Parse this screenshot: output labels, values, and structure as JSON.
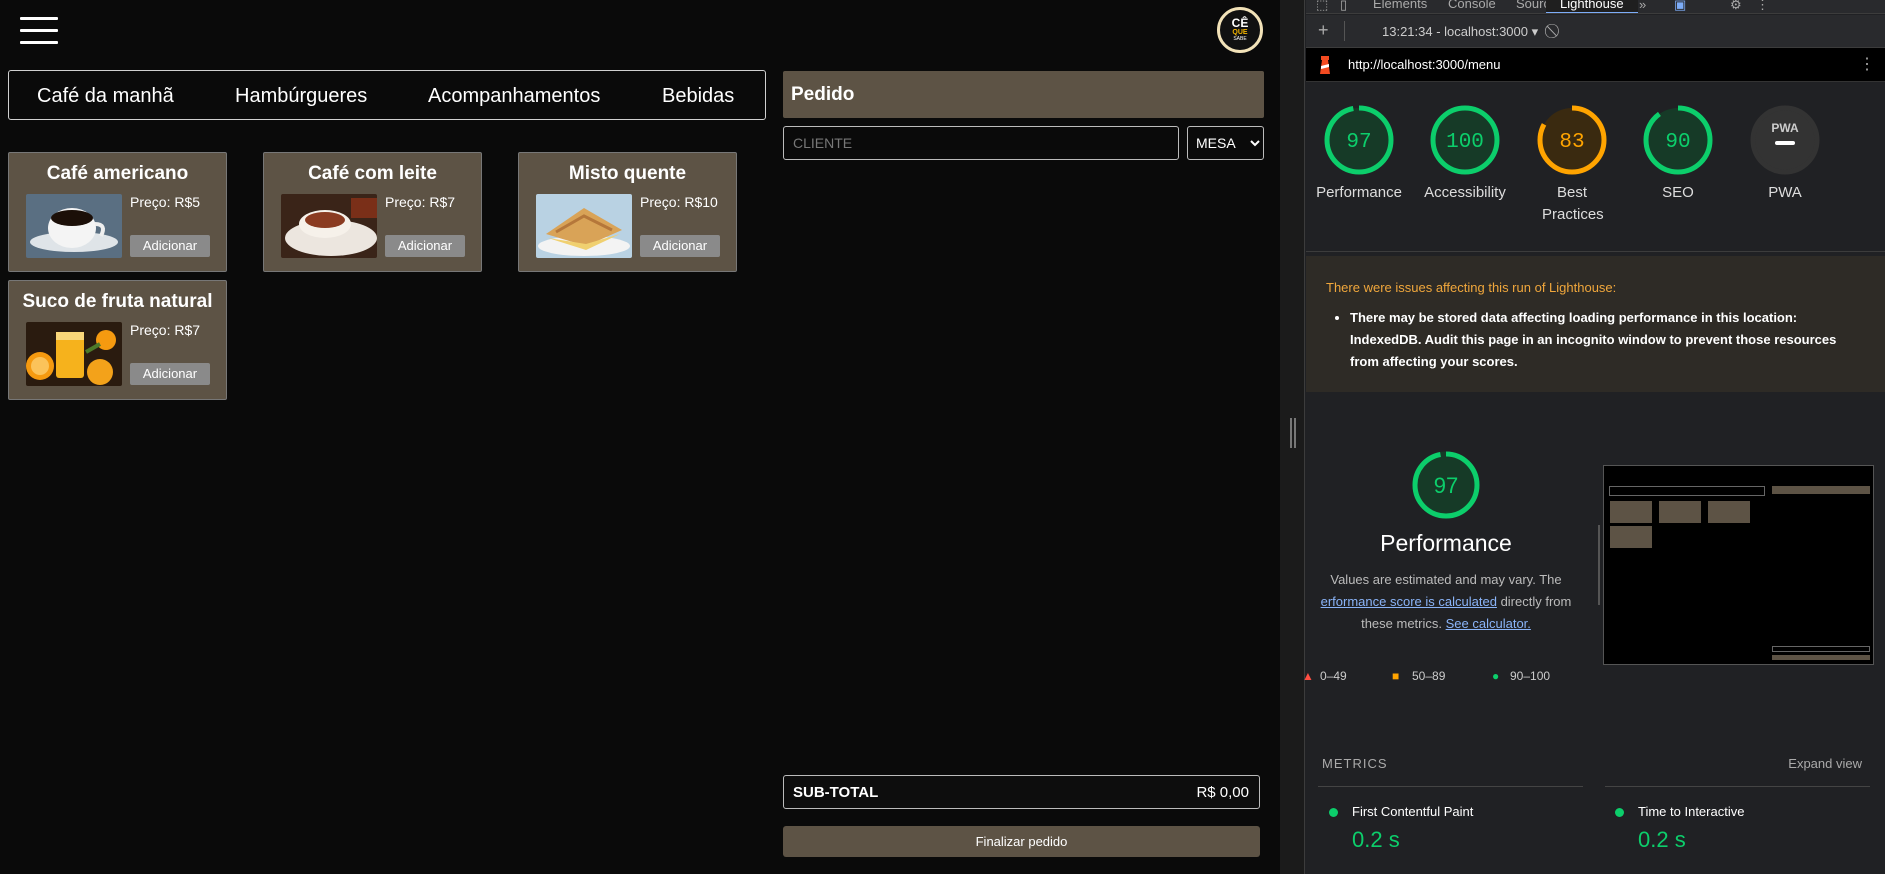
{
  "app": {
    "logo": {
      "line1": "CÊ",
      "line2": "QUE",
      "line3": "SABE"
    },
    "tabs": [
      "Café da manhã",
      "Hambúrgueres",
      "Acompanhamentos",
      "Bebidas"
    ],
    "products": [
      {
        "name": "Café americano",
        "price": "Preço: R$5",
        "add": "Adicionar"
      },
      {
        "name": "Café com leite",
        "price": "Preço: R$7",
        "add": "Adicionar"
      },
      {
        "name": "Misto quente",
        "price": "Preço: R$10",
        "add": "Adicionar"
      },
      {
        "name": "Suco de fruta natural",
        "price": "Preço: R$7",
        "add": "Adicionar"
      }
    ],
    "order": {
      "title": "Pedido",
      "client_placeholder": "CLIENTE",
      "table_value": "MESA",
      "subtotal_label": "SUB-TOTAL",
      "subtotal_value": "R$ 0,00",
      "finalize_label": "Finalizar pedido"
    }
  },
  "devtools": {
    "tabs": [
      "Elements",
      "Console",
      "Sources",
      "Lighthouse"
    ],
    "active_tab": "Lighthouse",
    "run_label": "13:21:34 - localhost:3000",
    "url": "http://localhost:3000/menu",
    "scores": [
      {
        "label": "Performance",
        "value": "97",
        "score": 97,
        "color": "#0cce6b"
      },
      {
        "label": "Accessibility",
        "value": "100",
        "score": 100,
        "color": "#0cce6b"
      },
      {
        "label": "Best Practices",
        "value": "83",
        "score": 83,
        "color": "#ffa400"
      },
      {
        "label": "SEO",
        "value": "90",
        "score": 90,
        "color": "#0cce6b"
      },
      {
        "label": "PWA",
        "value": "PWA",
        "score": null,
        "color": "#9e9e9e"
      }
    ],
    "warning": {
      "title": "There were issues affecting this run of Lighthouse:",
      "item": "There may be stored data affecting loading performance in this location: IndexedDB. Audit this page in an incognito window to prevent those resources from affecting your scores."
    },
    "performance": {
      "value": "97",
      "name": "Performance",
      "desc_before": "Values are estimated and may vary. The",
      "desc_link": "erformance score is calculated",
      "desc_after": "directly from these metrics.",
      "calc_link": "See calculator."
    },
    "legend": [
      "0–49",
      "50–89",
      "90–100"
    ],
    "metrics_title": "METRICS",
    "expand_label": "Expand view",
    "metrics": [
      {
        "name": "First Contentful Paint",
        "value": "0.2 s"
      },
      {
        "name": "Time to Interactive",
        "value": "0.2 s"
      }
    ]
  }
}
